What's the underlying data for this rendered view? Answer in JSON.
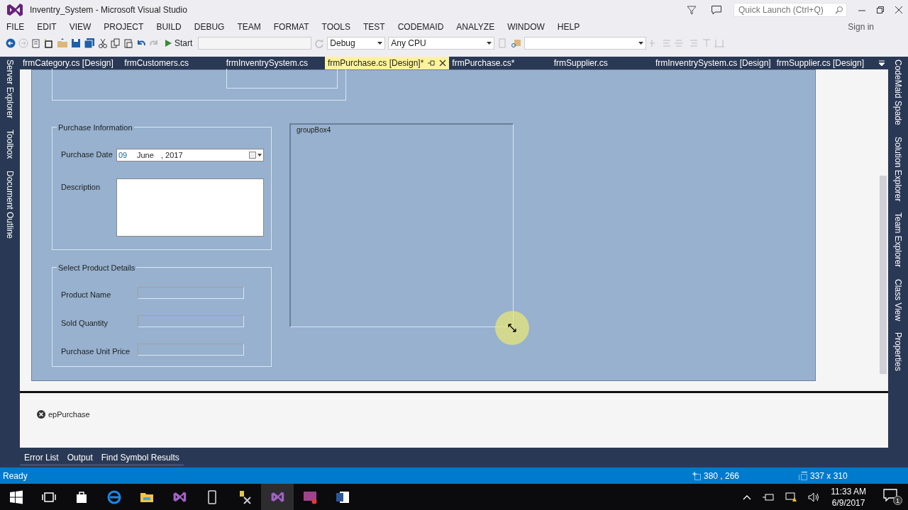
{
  "window": {
    "title": "Inventry_System - Microsoft Visual Studio"
  },
  "quick_launch": {
    "placeholder": "Quick Launch (Ctrl+Q)"
  },
  "menu": [
    "FILE",
    "EDIT",
    "VIEW",
    "PROJECT",
    "BUILD",
    "DEBUG",
    "TEAM",
    "FORMAT",
    "TOOLS",
    "TEST",
    "CODEMAID",
    "ANALYZE",
    "WINDOW",
    "HELP"
  ],
  "account": "Sign in",
  "toolbar": {
    "start": "Start",
    "configuration": "Debug",
    "platform": "Any CPU"
  },
  "document_tabs": [
    {
      "label": "frmCategory.cs [Design]",
      "selected": false
    },
    {
      "label": "frmCustomers.cs",
      "selected": false
    },
    {
      "label": "frmInventrySystem.cs",
      "selected": false
    },
    {
      "label": "frmPurchase.cs [Design]*",
      "selected": true
    },
    {
      "label": "frmPurchase.cs*",
      "selected": false
    },
    {
      "label": "frmSupplier.cs",
      "selected": false
    },
    {
      "label": "frmInventrySystem.cs [Design]",
      "selected": false
    },
    {
      "label": "frmSupplier.cs [Design]",
      "selected": false
    }
  ],
  "left_panel_tabs": [
    "Server Explorer",
    "Toolbox",
    "Document Outline"
  ],
  "right_panel_tabs": [
    "CodeMaid Spade",
    "Solution Explorer",
    "Team Explorer",
    "Class View",
    "Properties"
  ],
  "form": {
    "purchase_information": {
      "title": "Purchase Information",
      "date_label": "Purchase Date",
      "date_day": "09",
      "date_month": "June",
      "date_year": ", 2017",
      "description_label": "Description"
    },
    "product_details": {
      "title": "Select Product Details",
      "fields": [
        "Product Name",
        "Sold Quantity",
        "Purchase Unit Price"
      ]
    },
    "group_box_4": {
      "title": "groupBox4"
    }
  },
  "component_tray": [
    "epPurchase"
  ],
  "tool_window_tabs": [
    "Error List",
    "Output",
    "Find Symbol Results"
  ],
  "status_bar": {
    "text": "Ready",
    "position": "380 , 266",
    "size": "337 x 310"
  },
  "taskbar": {
    "time": "11:33 AM",
    "date": "6/9/2017",
    "notification_count": "1"
  }
}
